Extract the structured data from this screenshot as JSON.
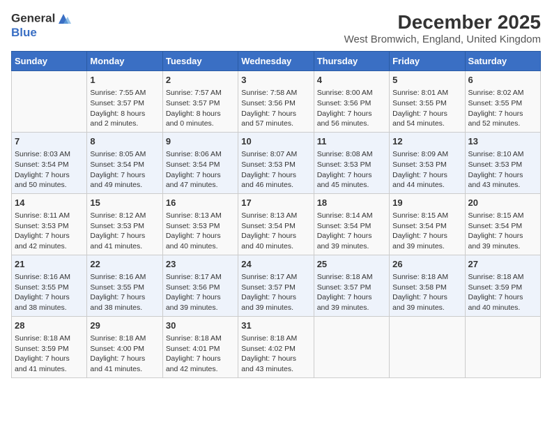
{
  "logo": {
    "line1": "General",
    "line2": "Blue"
  },
  "title": "December 2025",
  "subtitle": "West Bromwich, England, United Kingdom",
  "weekdays": [
    "Sunday",
    "Monday",
    "Tuesday",
    "Wednesday",
    "Thursday",
    "Friday",
    "Saturday"
  ],
  "weeks": [
    [
      {
        "day": "",
        "detail": ""
      },
      {
        "day": "1",
        "detail": "Sunrise: 7:55 AM\nSunset: 3:57 PM\nDaylight: 8 hours\nand 2 minutes."
      },
      {
        "day": "2",
        "detail": "Sunrise: 7:57 AM\nSunset: 3:57 PM\nDaylight: 8 hours\nand 0 minutes."
      },
      {
        "day": "3",
        "detail": "Sunrise: 7:58 AM\nSunset: 3:56 PM\nDaylight: 7 hours\nand 57 minutes."
      },
      {
        "day": "4",
        "detail": "Sunrise: 8:00 AM\nSunset: 3:56 PM\nDaylight: 7 hours\nand 56 minutes."
      },
      {
        "day": "5",
        "detail": "Sunrise: 8:01 AM\nSunset: 3:55 PM\nDaylight: 7 hours\nand 54 minutes."
      },
      {
        "day": "6",
        "detail": "Sunrise: 8:02 AM\nSunset: 3:55 PM\nDaylight: 7 hours\nand 52 minutes."
      }
    ],
    [
      {
        "day": "7",
        "detail": "Sunrise: 8:03 AM\nSunset: 3:54 PM\nDaylight: 7 hours\nand 50 minutes."
      },
      {
        "day": "8",
        "detail": "Sunrise: 8:05 AM\nSunset: 3:54 PM\nDaylight: 7 hours\nand 49 minutes."
      },
      {
        "day": "9",
        "detail": "Sunrise: 8:06 AM\nSunset: 3:54 PM\nDaylight: 7 hours\nand 47 minutes."
      },
      {
        "day": "10",
        "detail": "Sunrise: 8:07 AM\nSunset: 3:53 PM\nDaylight: 7 hours\nand 46 minutes."
      },
      {
        "day": "11",
        "detail": "Sunrise: 8:08 AM\nSunset: 3:53 PM\nDaylight: 7 hours\nand 45 minutes."
      },
      {
        "day": "12",
        "detail": "Sunrise: 8:09 AM\nSunset: 3:53 PM\nDaylight: 7 hours\nand 44 minutes."
      },
      {
        "day": "13",
        "detail": "Sunrise: 8:10 AM\nSunset: 3:53 PM\nDaylight: 7 hours\nand 43 minutes."
      }
    ],
    [
      {
        "day": "14",
        "detail": "Sunrise: 8:11 AM\nSunset: 3:53 PM\nDaylight: 7 hours\nand 42 minutes."
      },
      {
        "day": "15",
        "detail": "Sunrise: 8:12 AM\nSunset: 3:53 PM\nDaylight: 7 hours\nand 41 minutes."
      },
      {
        "day": "16",
        "detail": "Sunrise: 8:13 AM\nSunset: 3:53 PM\nDaylight: 7 hours\nand 40 minutes."
      },
      {
        "day": "17",
        "detail": "Sunrise: 8:13 AM\nSunset: 3:54 PM\nDaylight: 7 hours\nand 40 minutes."
      },
      {
        "day": "18",
        "detail": "Sunrise: 8:14 AM\nSunset: 3:54 PM\nDaylight: 7 hours\nand 39 minutes."
      },
      {
        "day": "19",
        "detail": "Sunrise: 8:15 AM\nSunset: 3:54 PM\nDaylight: 7 hours\nand 39 minutes."
      },
      {
        "day": "20",
        "detail": "Sunrise: 8:15 AM\nSunset: 3:54 PM\nDaylight: 7 hours\nand 39 minutes."
      }
    ],
    [
      {
        "day": "21",
        "detail": "Sunrise: 8:16 AM\nSunset: 3:55 PM\nDaylight: 7 hours\nand 38 minutes."
      },
      {
        "day": "22",
        "detail": "Sunrise: 8:16 AM\nSunset: 3:55 PM\nDaylight: 7 hours\nand 38 minutes."
      },
      {
        "day": "23",
        "detail": "Sunrise: 8:17 AM\nSunset: 3:56 PM\nDaylight: 7 hours\nand 39 minutes."
      },
      {
        "day": "24",
        "detail": "Sunrise: 8:17 AM\nSunset: 3:57 PM\nDaylight: 7 hours\nand 39 minutes."
      },
      {
        "day": "25",
        "detail": "Sunrise: 8:18 AM\nSunset: 3:57 PM\nDaylight: 7 hours\nand 39 minutes."
      },
      {
        "day": "26",
        "detail": "Sunrise: 8:18 AM\nSunset: 3:58 PM\nDaylight: 7 hours\nand 39 minutes."
      },
      {
        "day": "27",
        "detail": "Sunrise: 8:18 AM\nSunset: 3:59 PM\nDaylight: 7 hours\nand 40 minutes."
      }
    ],
    [
      {
        "day": "28",
        "detail": "Sunrise: 8:18 AM\nSunset: 3:59 PM\nDaylight: 7 hours\nand 41 minutes."
      },
      {
        "day": "29",
        "detail": "Sunrise: 8:18 AM\nSunset: 4:00 PM\nDaylight: 7 hours\nand 41 minutes."
      },
      {
        "day": "30",
        "detail": "Sunrise: 8:18 AM\nSunset: 4:01 PM\nDaylight: 7 hours\nand 42 minutes."
      },
      {
        "day": "31",
        "detail": "Sunrise: 8:18 AM\nSunset: 4:02 PM\nDaylight: 7 hours\nand 43 minutes."
      },
      {
        "day": "",
        "detail": ""
      },
      {
        "day": "",
        "detail": ""
      },
      {
        "day": "",
        "detail": ""
      }
    ]
  ]
}
